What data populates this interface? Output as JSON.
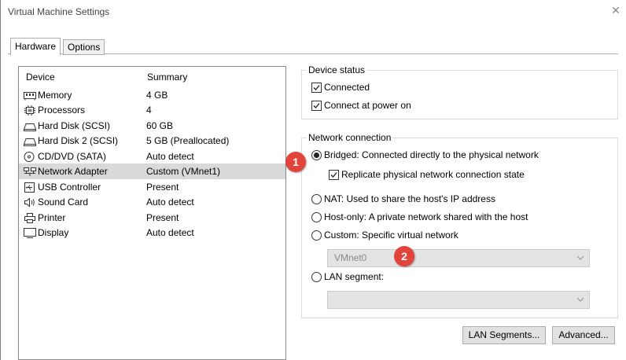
{
  "window": {
    "title": "Virtual Machine Settings",
    "close_glyph": "✕"
  },
  "tabs": [
    {
      "label": "Hardware"
    },
    {
      "label": "Options"
    }
  ],
  "device_list": {
    "col_device": "Device",
    "col_summary": "Summary",
    "items": [
      {
        "name": "Memory",
        "summary": "4 GB",
        "icon": "memory-icon"
      },
      {
        "name": "Processors",
        "summary": "4",
        "icon": "processor-icon"
      },
      {
        "name": "Hard Disk (SCSI)",
        "summary": "60 GB",
        "icon": "hard-disk-icon"
      },
      {
        "name": "Hard Disk 2 (SCSI)",
        "summary": "5 GB (Preallocated)",
        "icon": "hard-disk-icon"
      },
      {
        "name": "CD/DVD (SATA)",
        "summary": "Auto detect",
        "icon": "cd-dvd-icon"
      },
      {
        "name": "Network Adapter",
        "summary": "Custom (VMnet1)",
        "icon": "network-adapter-icon",
        "selected": true
      },
      {
        "name": "USB Controller",
        "summary": "Present",
        "icon": "usb-icon"
      },
      {
        "name": "Sound Card",
        "summary": "Auto detect",
        "icon": "sound-icon"
      },
      {
        "name": "Printer",
        "summary": "Present",
        "icon": "printer-icon"
      },
      {
        "name": "Display",
        "summary": "Auto detect",
        "icon": "display-icon"
      }
    ]
  },
  "device_status": {
    "label": "Device status",
    "connected": {
      "label": "Connected",
      "checked": true
    },
    "connect_at_power_on": {
      "label": "Connect at power on",
      "checked": true
    }
  },
  "network_connection": {
    "label": "Network connection",
    "bridged": {
      "label": "Bridged: Connected directly to the physical network",
      "selected": true
    },
    "replicate": {
      "label": "Replicate physical network connection state",
      "checked": true
    },
    "nat": {
      "label": "NAT: Used to share the host's IP address"
    },
    "host_only": {
      "label": "Host-only: A private network shared with the host"
    },
    "custom": {
      "label": "Custom: Specific virtual network"
    },
    "custom_select": {
      "value": "VMnet0"
    },
    "lan_segment": {
      "label": "LAN segment:"
    },
    "lan_select": {
      "value": ""
    }
  },
  "buttons": {
    "lan_segments": "LAN Segments...",
    "advanced": "Advanced..."
  },
  "callouts": [
    {
      "label": "1"
    },
    {
      "label": "2"
    }
  ],
  "colors": {
    "callout": "#e2433a",
    "selected_row": "#d9d9d9"
  }
}
